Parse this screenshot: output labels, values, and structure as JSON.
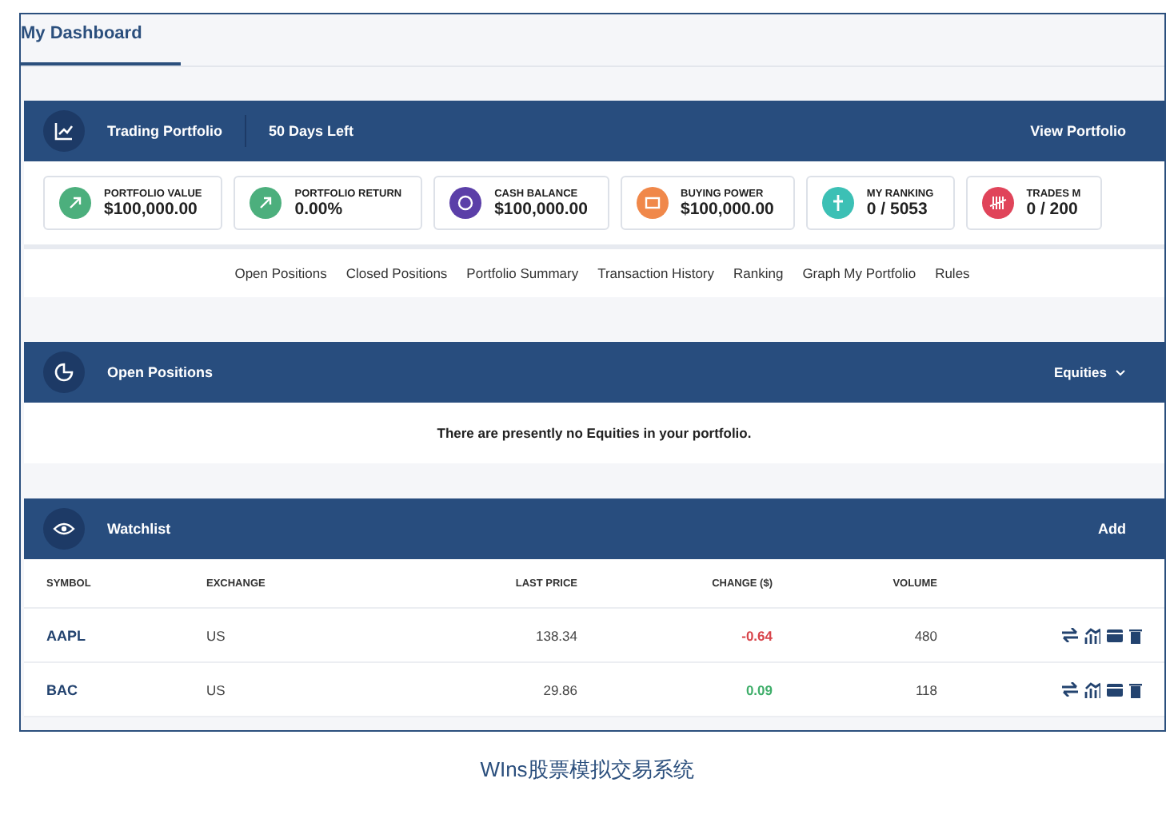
{
  "tabs": [
    {
      "label": "My Dashboard",
      "selected": true
    }
  ],
  "portfolio_bar": {
    "title": "Trading Portfolio",
    "days_left": "50 Days Left",
    "link": "View Portfolio"
  },
  "stats": [
    {
      "label": "PORTFOLIO VALUE",
      "value": "$100,000.00",
      "color": "#4caf7d",
      "kind": "up"
    },
    {
      "label": "PORTFOLIO RETURN",
      "value": "0.00%",
      "color": "#4caf7d",
      "kind": "up"
    },
    {
      "label": "CASH BALANCE",
      "value": "$100,000.00",
      "color": "#5b3fa8",
      "kind": "coin"
    },
    {
      "label": "BUYING POWER",
      "value": "$100,000.00",
      "color": "#f0884a",
      "kind": "wallet"
    },
    {
      "label": "MY RANKING",
      "value": "0 / 5053",
      "color": "#3cc0b5",
      "kind": "person"
    },
    {
      "label": "TRADES M",
      "value": "0 / 200",
      "color": "#e0445a",
      "kind": "tally"
    }
  ],
  "nav_links": [
    "Open Positions",
    "Closed Positions",
    "Portfolio Summary",
    "Transaction History",
    "Ranking",
    "Graph My Portfolio",
    "Rules"
  ],
  "open_positions": {
    "title": "Open Positions",
    "filter": "Equities",
    "message": "There are presently no Equities in your portfolio."
  },
  "watchlist": {
    "title": "Watchlist",
    "action": "Add",
    "columns": [
      "SYMBOL",
      "EXCHANGE",
      "LAST PRICE",
      "CHANGE ($)",
      "VOLUME"
    ],
    "rows": [
      {
        "symbol": "AAPL",
        "exchange": "US",
        "last_price": "138.34",
        "change": "-0.64",
        "color": "#d8454b",
        "volume": "480"
      },
      {
        "symbol": "BAC",
        "exchange": "US",
        "last_price": "29.86",
        "change": "0.09",
        "color": "#3fae6a",
        "volume": "118"
      }
    ]
  },
  "caption": "WIns股票模拟交易系统"
}
